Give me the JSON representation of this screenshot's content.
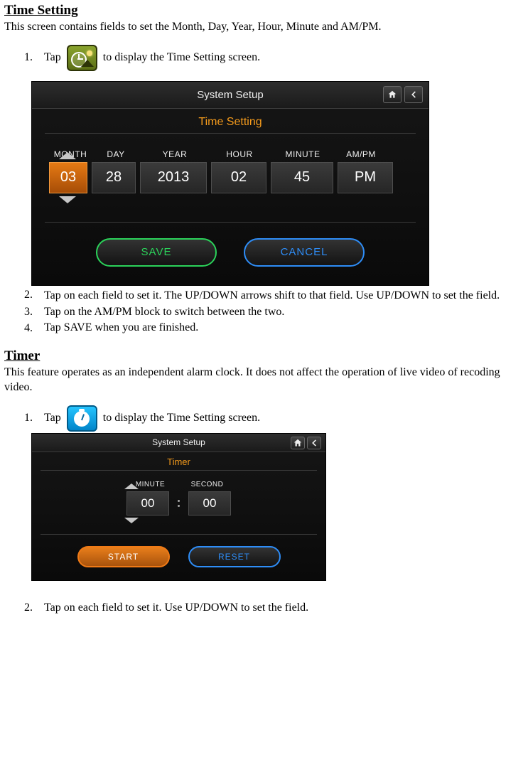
{
  "section1": {
    "heading": "Time Setting",
    "intro": "This screen contains fields to set the Month, Day, Year, Hour, Minute and AM/PM.",
    "step1_num": "1.",
    "step1_pre": "Tap",
    "step1_post": " to display the Time Setting screen.",
    "step2_num": "2.",
    "step2": "Tap on each field to set it. The UP/DOWN arrows shift to that field. Use UP/DOWN to set the field.",
    "step3_num": "3.",
    "step3": "Tap on the AM/PM block to switch between the two.",
    "step4_num": "4.",
    "step4": "Tap SAVE when you are finished."
  },
  "shot1": {
    "header": "System Setup",
    "subtitle": "Time Setting",
    "labels": {
      "month": "MONTH",
      "day": "DAY",
      "year": "YEAR",
      "hour": "HOUR",
      "minute": "MINUTE",
      "ampm": "AM/PM"
    },
    "values": {
      "month": "03",
      "day": "28",
      "year": "2013",
      "hour": "02",
      "minute": "45",
      "ampm": "PM"
    },
    "save": "SAVE",
    "cancel": "CANCEL"
  },
  "section2": {
    "heading": "Timer",
    "intro": "This feature operates as an independent alarm clock. It does not affect the operation of live video of recoding video.",
    "step1_num": "1.",
    "step1_pre": "Tap",
    "step1_post": " to display the Time Setting screen.",
    "step2_num": "2.",
    "step2": "Tap on each field to set it. Use UP/DOWN to set the field."
  },
  "shot2": {
    "header": "System Setup",
    "subtitle": "Timer",
    "labels": {
      "minute": "MINUTE",
      "second": "SECOND"
    },
    "values": {
      "minute": "00",
      "second": "00"
    },
    "start": "START",
    "reset": "RESET"
  }
}
